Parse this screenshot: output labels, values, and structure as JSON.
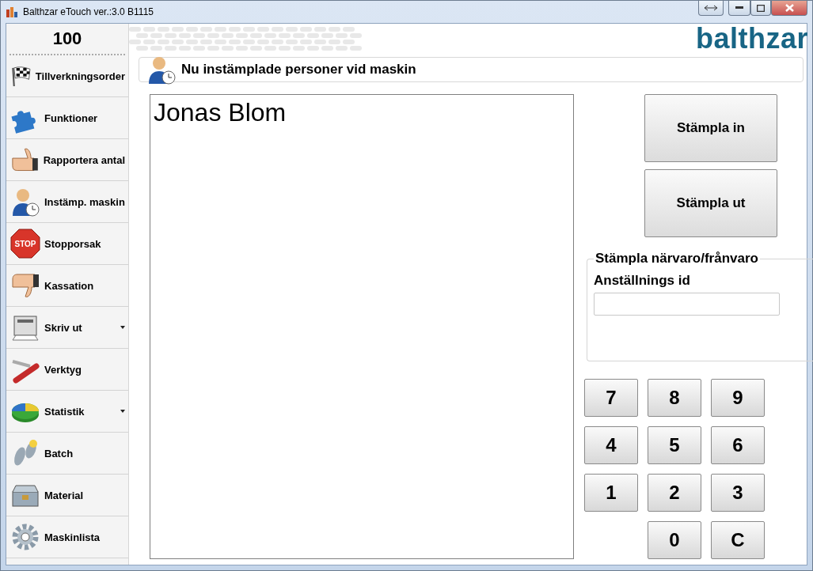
{
  "window": {
    "title": "Balthzar eTouch ver.:3.0 B1115"
  },
  "sidebar": {
    "counter": "100",
    "items": [
      {
        "label": "Tillverkningsorder",
        "has_menu": false
      },
      {
        "label": "Funktioner",
        "has_menu": false
      },
      {
        "label": "Rapportera antal",
        "has_menu": false
      },
      {
        "label": "Instämp. maskin",
        "has_menu": false
      },
      {
        "label": "Stopporsak",
        "icon_text": "STOP",
        "has_menu": false
      },
      {
        "label": "Kassation",
        "has_menu": false
      },
      {
        "label": "Skriv ut",
        "has_menu": true
      },
      {
        "label": "Verktyg",
        "has_menu": false
      },
      {
        "label": "Statistik",
        "has_menu": true
      },
      {
        "label": "Batch",
        "has_menu": false
      },
      {
        "label": "Material",
        "has_menu": false
      },
      {
        "label": "Maskinlista",
        "has_menu": false
      }
    ]
  },
  "header": {
    "logo": "balthzar"
  },
  "panel": {
    "title": "Nu instämplade personer vid maskin",
    "persons": [
      "Jonas Blom"
    ]
  },
  "actions": [
    "Stämpla in",
    "Stämpla ut"
  ],
  "attendance": {
    "legend": "Stämpla närvaro/frånvaro",
    "label": "Anställnings id"
  },
  "keypad": {
    "rows": [
      [
        "7",
        "8",
        "9"
      ],
      [
        "4",
        "5",
        "6"
      ],
      [
        "1",
        "2",
        "3"
      ],
      [
        "",
        "0",
        "C"
      ]
    ]
  }
}
